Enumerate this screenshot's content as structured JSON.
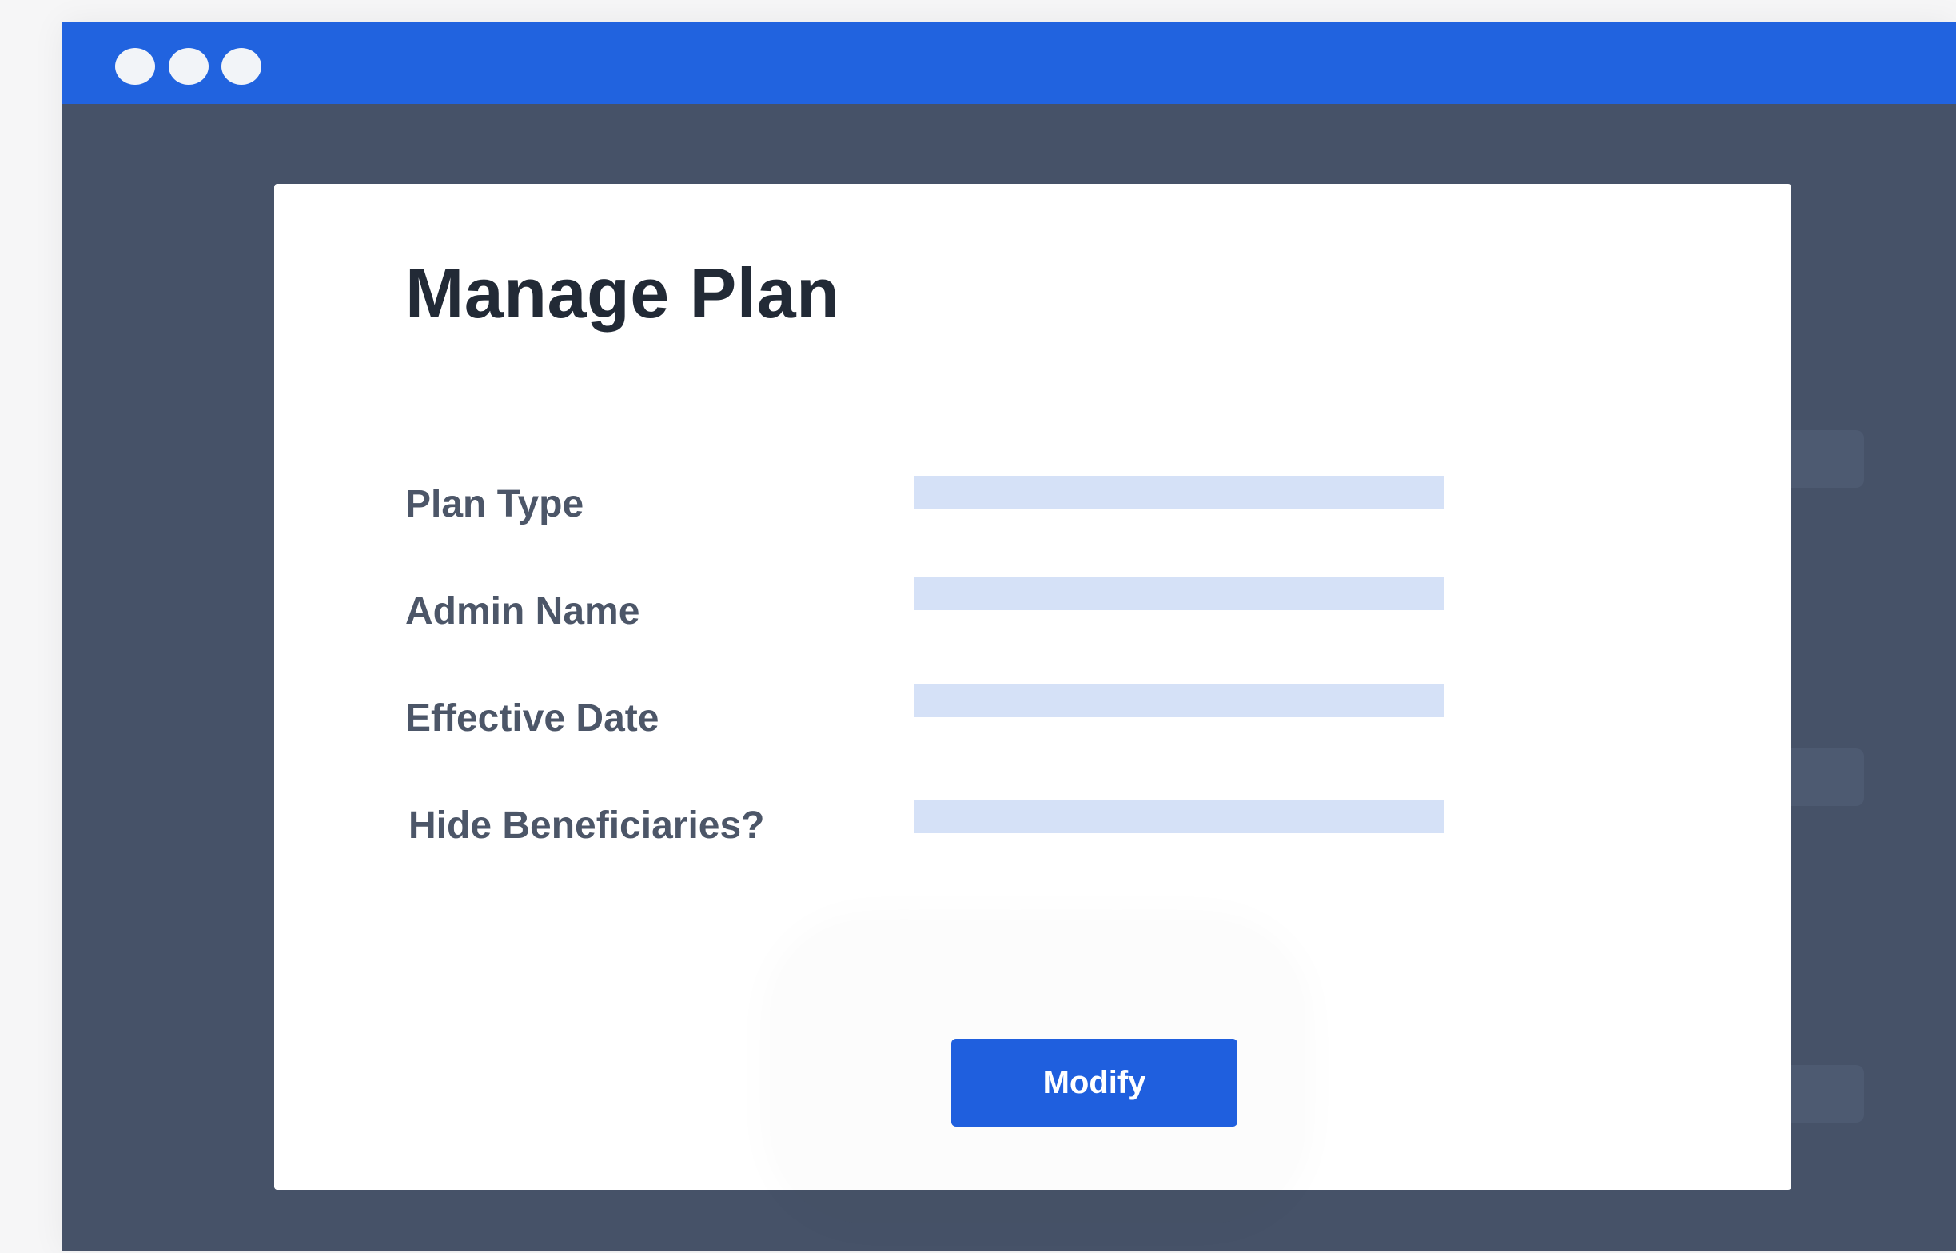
{
  "window": {
    "controls": [
      "window-dot-icon",
      "window-dot-icon",
      "window-dot-icon"
    ]
  },
  "modal": {
    "title": "Manage Plan",
    "fields": [
      {
        "label": "Plan Type",
        "value": ""
      },
      {
        "label": "Admin Name",
        "value": ""
      },
      {
        "label": "Effective Date",
        "value": ""
      },
      {
        "label": "Hide Beneficiaries?",
        "value": ""
      }
    ],
    "submit_label": "Modify"
  },
  "colors": {
    "titlebar": "#2163df",
    "backdrop": "#465268",
    "input_fill": "#d5e1f7",
    "button": "#1f5fde"
  }
}
